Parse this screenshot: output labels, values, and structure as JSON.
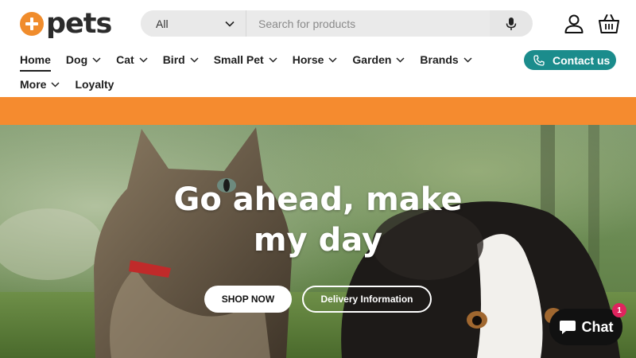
{
  "brand": {
    "logo_text": "pets",
    "accent": "#f08c2c"
  },
  "search": {
    "category": "All",
    "placeholder": "Search for products",
    "value": ""
  },
  "header_icons": [
    "account-icon",
    "basket-icon"
  ],
  "nav": {
    "items": [
      {
        "label": "Home",
        "dropdown": false,
        "active": true
      },
      {
        "label": "Dog",
        "dropdown": true
      },
      {
        "label": "Cat",
        "dropdown": true
      },
      {
        "label": "Bird",
        "dropdown": true
      },
      {
        "label": "Small Pet",
        "dropdown": true
      },
      {
        "label": "Horse",
        "dropdown": true
      },
      {
        "label": "Garden",
        "dropdown": true
      },
      {
        "label": "Brands",
        "dropdown": true
      }
    ],
    "items_row2": [
      {
        "label": "More",
        "dropdown": true
      },
      {
        "label": "Loyalty",
        "dropdown": false
      }
    ]
  },
  "contact": {
    "label": "Contact us",
    "color": "#1b8c8c"
  },
  "band_color": "#f58b2f",
  "hero": {
    "title_line1": "Go ahead, make",
    "title_line2": "my day",
    "primary_button": "SHOP NOW",
    "secondary_button": "Delivery Information"
  },
  "chat": {
    "label": "Chat",
    "badge": "1"
  }
}
